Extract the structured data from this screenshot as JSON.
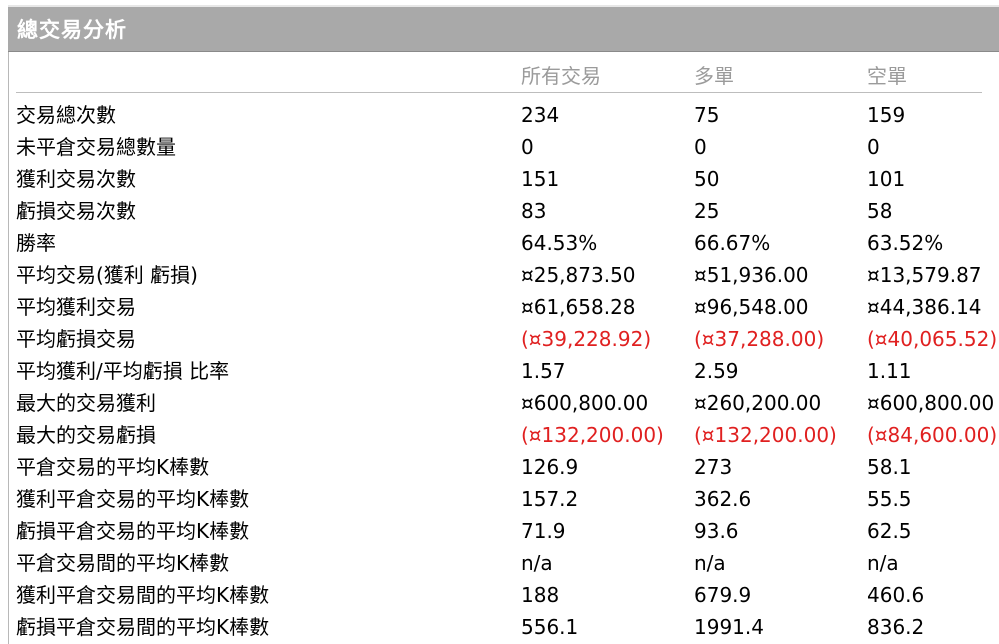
{
  "title": "總交易分析",
  "columns": {
    "all": "所有交易",
    "long": "多單",
    "short": "空單"
  },
  "rows": [
    {
      "label": "交易總次數",
      "all": "234",
      "long": "75",
      "short": "159"
    },
    {
      "label": "未平倉交易總數量",
      "all": "0",
      "long": "0",
      "short": "0"
    },
    {
      "label": "獲利交易次數",
      "all": "151",
      "long": "50",
      "short": "101"
    },
    {
      "label": "虧損交易次數",
      "all": "83",
      "long": "25",
      "short": "58"
    },
    {
      "label": "勝率",
      "all": "64.53%",
      "long": "66.67%",
      "short": "63.52%"
    },
    {
      "label": "平均交易(獲利  虧損)",
      "all": "¤25,873.50",
      "long": "¤51,936.00",
      "short": "¤13,579.87"
    },
    {
      "label": "平均獲利交易",
      "all": "¤61,658.28",
      "long": "¤96,548.00",
      "short": "¤44,386.14"
    },
    {
      "label": "平均虧損交易",
      "all": "(¤39,228.92)",
      "long": "(¤37,288.00)",
      "short": "(¤40,065.52)",
      "negative": true
    },
    {
      "label": "平均獲利/平均虧損  比率",
      "all": "1.57",
      "long": "2.59",
      "short": "1.11"
    },
    {
      "label": "最大的交易獲利",
      "all": "¤600,800.00",
      "long": "¤260,200.00",
      "short": "¤600,800.00"
    },
    {
      "label": "最大的交易虧損",
      "all": "(¤132,200.00)",
      "long": "(¤132,200.00)",
      "short": "(¤84,600.00)",
      "negative": true
    },
    {
      "label": "平倉交易的平均K棒數",
      "all": "126.9",
      "long": "273",
      "short": "58.1"
    },
    {
      "label": "獲利平倉交易的平均K棒數",
      "all": "157.2",
      "long": "362.6",
      "short": "55.5"
    },
    {
      "label": "虧損平倉交易的平均K棒數",
      "all": "71.9",
      "long": "93.6",
      "short": "62.5"
    },
    {
      "label": "平倉交易間的平均K棒數",
      "all": "n/a",
      "long": "n/a",
      "short": "n/a"
    },
    {
      "label": "獲利平倉交易間的平均K棒數",
      "all": "188",
      "long": "679.9",
      "short": "460.6"
    },
    {
      "label": "虧損平倉交易間的平均K棒數",
      "all": "556.1",
      "long": "1991.4",
      "short": "836.2"
    }
  ],
  "colors": {
    "title_bar": "#a9a9a9",
    "negative": "#e02020",
    "header_text": "#9b9b9b"
  }
}
